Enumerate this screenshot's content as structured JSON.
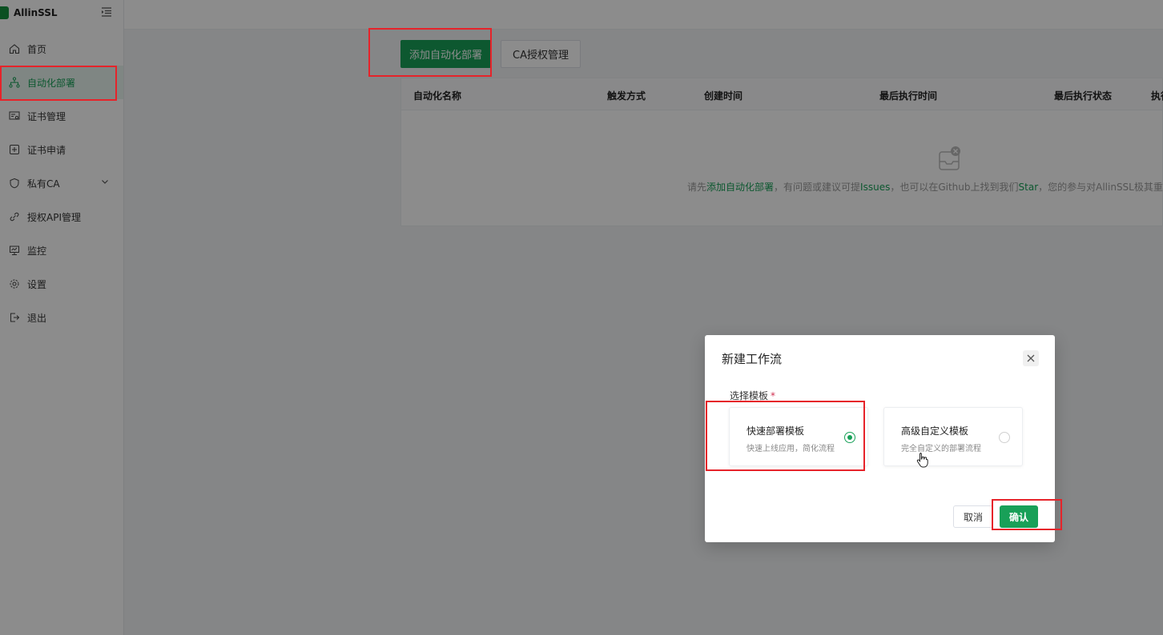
{
  "app": {
    "title": "AllinSSL"
  },
  "sidebar": {
    "items": [
      {
        "label": "首页",
        "icon": "home-icon"
      },
      {
        "label": "自动化部署",
        "icon": "workflow-icon"
      },
      {
        "label": "证书管理",
        "icon": "certificate-icon"
      },
      {
        "label": "证书申请",
        "icon": "plus-square-icon"
      },
      {
        "label": "私有CA",
        "icon": "shield-icon"
      },
      {
        "label": "授权API管理",
        "icon": "link-icon"
      },
      {
        "label": "监控",
        "icon": "monitor-icon"
      },
      {
        "label": "设置",
        "icon": "gear-icon"
      },
      {
        "label": "退出",
        "icon": "logout-icon"
      }
    ],
    "active_index": 1
  },
  "toolbar": {
    "add_label": "添加自动化部署",
    "ca_label": "CA授权管理"
  },
  "table": {
    "columns": [
      "自动化名称",
      "触发方式",
      "创建时间",
      "最后执行时间",
      "最后执行状态",
      "执行"
    ],
    "empty": {
      "prefix": "请先",
      "link1": "添加自动化部署",
      "mid1": "，有问题或建议可提",
      "link2": "Issues",
      "mid2": "，也可以在Github上找到我们",
      "link3": "Star",
      "suffix": "，您的参与对AllinSSL极其重"
    }
  },
  "modal": {
    "title": "新建工作流",
    "field_label": "选择模板",
    "templates": [
      {
        "title": "快速部署模板",
        "desc": "快速上线应用，简化流程",
        "selected": true
      },
      {
        "title": "高级自定义模板",
        "desc": "完全自定义的部署流程",
        "selected": false
      }
    ],
    "cancel_label": "取消",
    "confirm_label": "确认"
  },
  "colors": {
    "accent": "#18a058",
    "annotation": "#e6232a"
  }
}
